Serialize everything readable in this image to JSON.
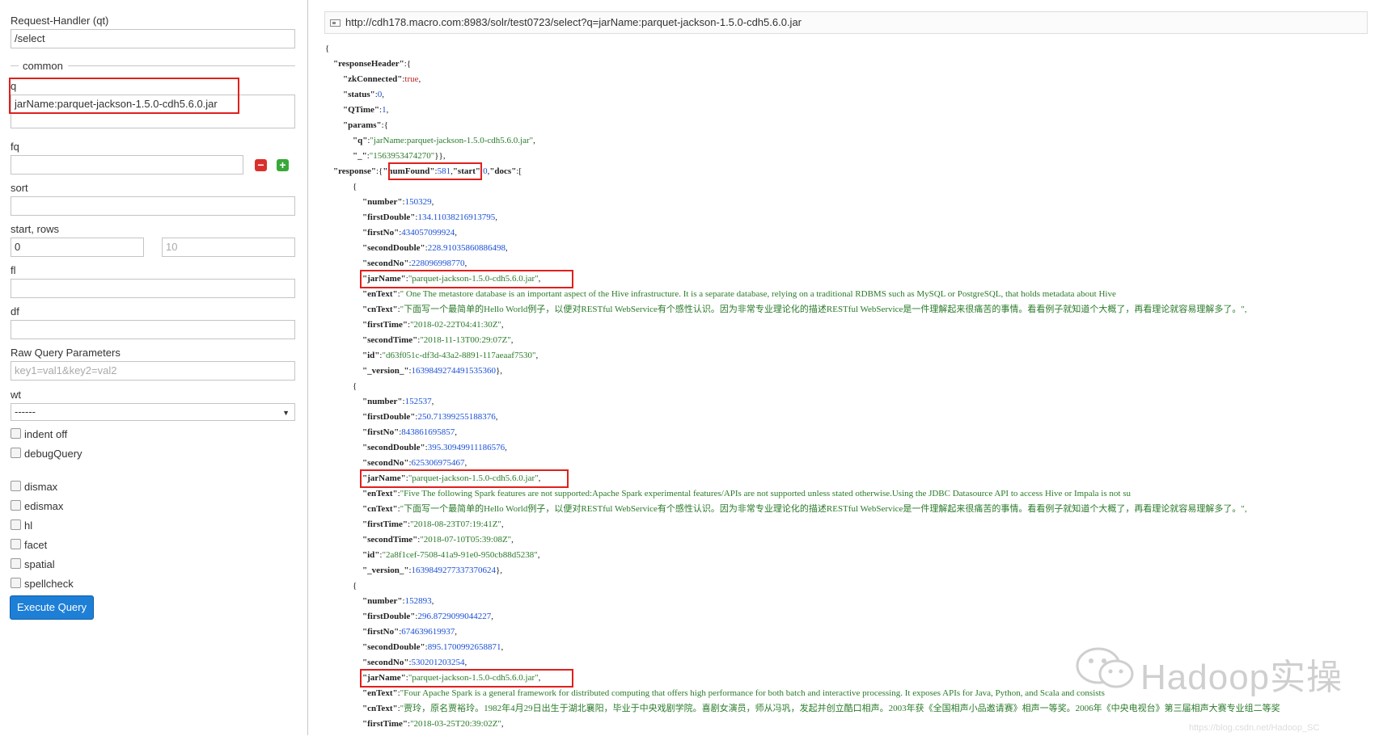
{
  "left": {
    "request_handler_label": "Request-Handler (qt)",
    "request_handler_value": "/select",
    "common_legend": "common",
    "q_label": "q",
    "q_value": "jarName:parquet-jackson-1.5.0-cdh5.6.0.jar",
    "fq_label": "fq",
    "fq_value": "",
    "sort_label": "sort",
    "sort_value": "",
    "start_rows_label": "start, rows",
    "start_value": "0",
    "rows_value": "10",
    "fl_label": "fl",
    "fl_value": "",
    "df_label": "df",
    "df_value": "",
    "raw_label": "Raw Query Parameters",
    "raw_placeholder": "key1=val1&key2=val2",
    "wt_label": "wt",
    "wt_value": "------",
    "checkboxes": [
      "indent off",
      "debugQuery",
      "dismax",
      "edismax",
      "hl",
      "facet",
      "spatial",
      "spellcheck"
    ],
    "execute_label": "Execute Query"
  },
  "right": {
    "url": "http://cdh178.macro.com:8983/solr/test0723/select?q=jarName:parquet-jackson-1.5.0-cdh5.6.0.jar"
  },
  "response": {
    "zkConnected": "true",
    "status": "0",
    "QTime": "1",
    "params_q": "\"jarName:parquet-jackson-1.5.0-cdh5.6.0.jar\"",
    "params_underscore": "\"1563953474270\"",
    "numFound": "581",
    "start": "0",
    "docs": [
      {
        "number": "150329",
        "firstDouble": "134.11038216913795",
        "firstNo": "434057099924",
        "secondDouble": "228.91035860886498",
        "secondNo": "228096998770",
        "jarName": "\"parquet-jackson-1.5.0-cdh5.6.0.jar\"",
        "enText": "\" One The metastore database is an important aspect of the Hive infrastructure. It is a separate database,  relying on a traditional RDBMS such as MySQL or PostgreSQL,  that holds metadata about Hive",
        "cnText": "\"下面写一个最简单的Hello World例子，以便对RESTful WebService有个感性认识。因为非常专业理论化的描述RESTful WebService是一件理解起来很痛苦的事情。看看例子就知道个大概了，再看理论就容易理解多了。\",",
        "firstTime": "\"2018-02-22T04:41:30Z\"",
        "secondTime": "\"2018-11-13T00:29:07Z\"",
        "id": "\"d63f051c-df3d-43a2-8891-117aeaaf7530\"",
        "version": "1639849274491535360"
      },
      {
        "number": "152537",
        "firstDouble": "250.71399255188376",
        "firstNo": "843861695857",
        "secondDouble": "395.30949911186576",
        "secondNo": "625306975467",
        "jarName": "\"parquet-jackson-1.5.0-cdh5.6.0.jar\"",
        "enText": "\"Five The following Spark features are not supported:Apache Spark experimental features/APIs are not supported unless stated otherwise.Using the JDBC Datasource API to access Hive or Impala is not su",
        "cnText": "\"下面写一个最简单的Hello World例子，以便对RESTful WebService有个感性认识。因为非常专业理论化的描述RESTful WebService是一件理解起来很痛苦的事情。看看例子就知道个大概了，再看理论就容易理解多了。\",",
        "firstTime": "\"2018-08-23T07:19:41Z\"",
        "secondTime": "\"2018-07-10T05:39:08Z\"",
        "id": "\"2a8f1cef-7508-41a9-91e0-950cb88d5238\"",
        "version": "1639849277337370624"
      },
      {
        "number": "152893",
        "firstDouble": "296.8729099044227",
        "firstNo": "674639619937",
        "secondDouble": "895.1700992658871",
        "secondNo": "530201203254",
        "jarName": "\"parquet-jackson-1.5.0-cdh5.6.0.jar\"",
        "enText": "\"Four Apache Spark is a general framework for distributed computing that offers high performance for both batch and interactive processing. It exposes APIs for Java,  Python,  and Scala and consists",
        "cnText": "\"贾玲，原名贾裕玲。1982年4月29日出生于湖北襄阳，毕业于中央戏剧学院。喜剧女演员，师从冯巩，发起并创立酷口相声。2003年获《全国相声小品邀请赛》相声一等奖。2006年《中央电视台》第三届相声大赛专业组二等奖",
        "firstTime": "\"2018-03-25T20:39:02Z\""
      }
    ]
  },
  "watermark": {
    "brand": "Hadoop实操",
    "url": "https://blog.csdn.net/Hadoop_SC"
  }
}
